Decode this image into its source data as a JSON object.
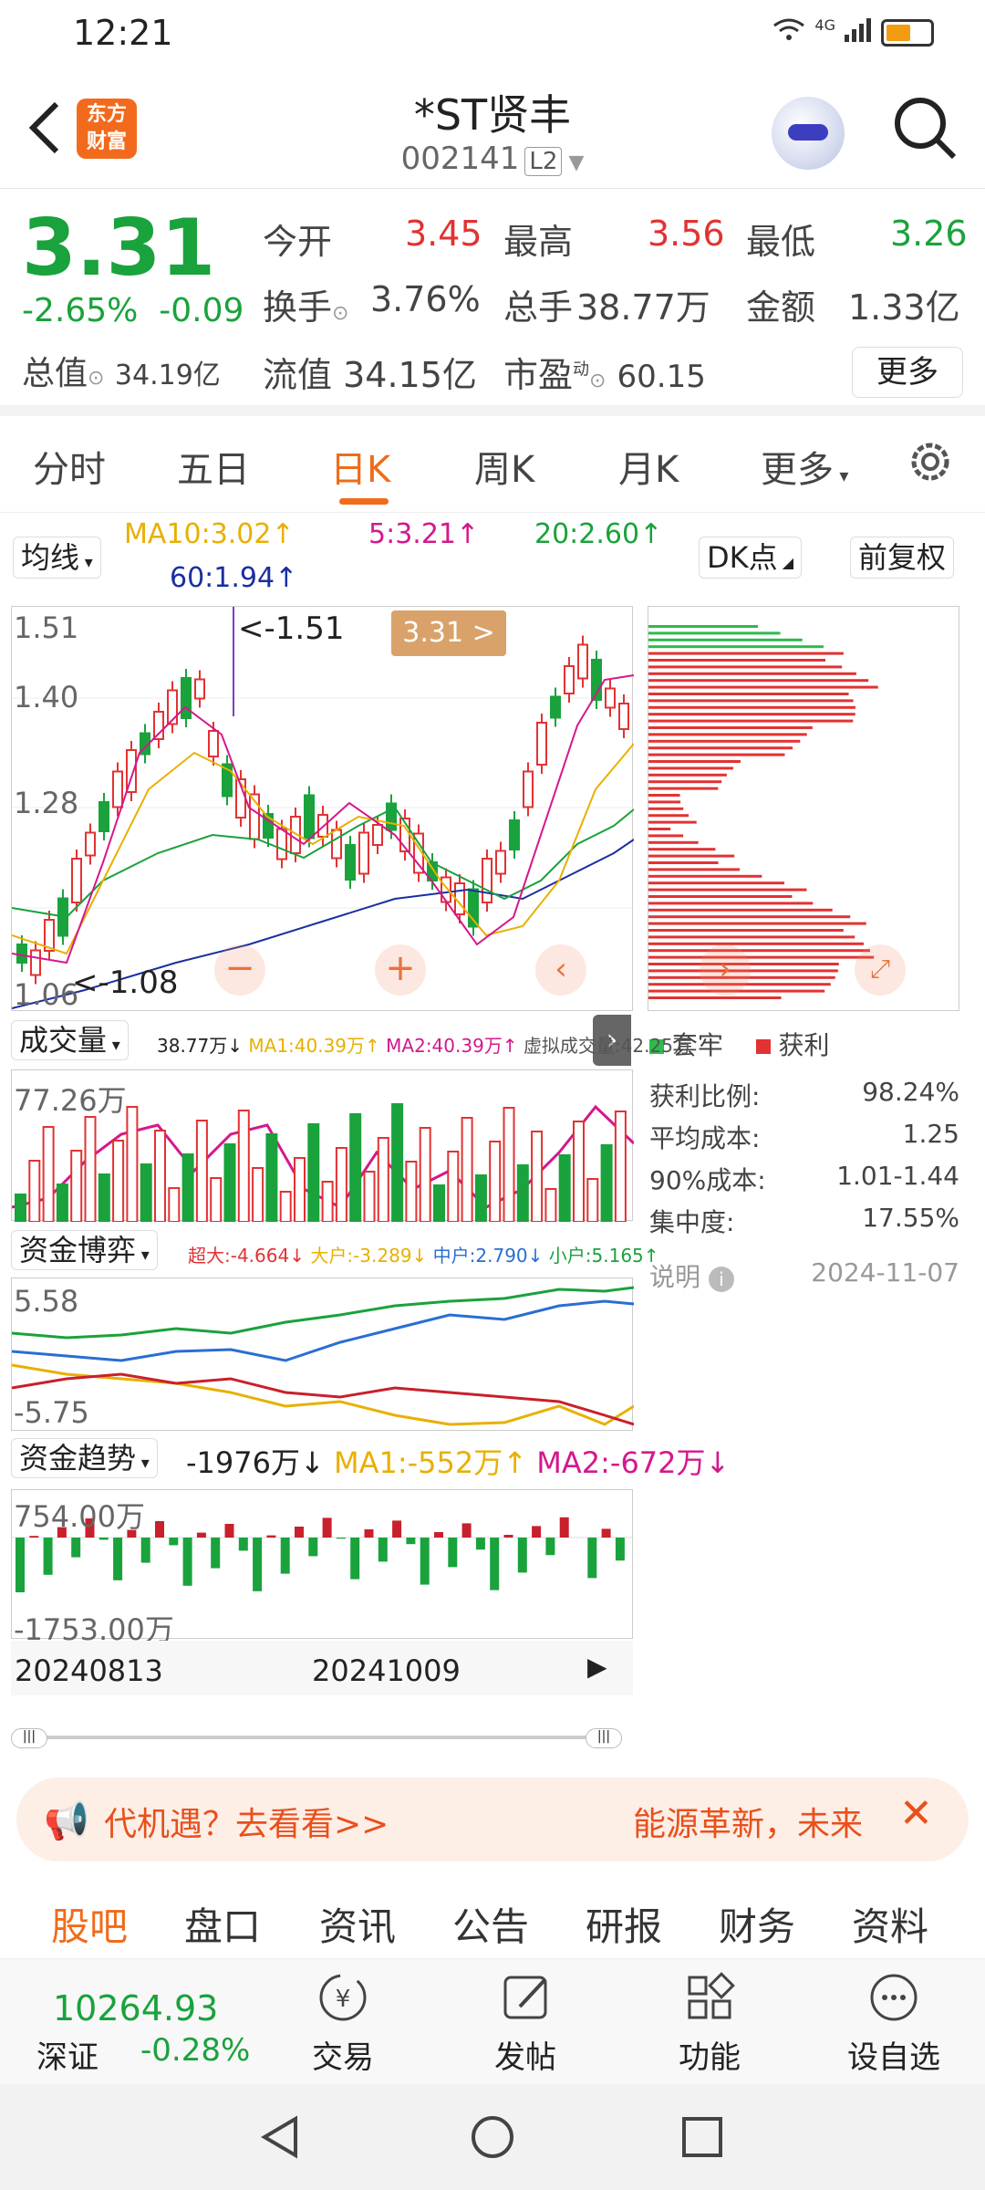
{
  "status": {
    "time": "12:21",
    "network": "4G"
  },
  "header": {
    "title": "*ST贤丰",
    "code": "002141",
    "level": "L2",
    "logo": [
      "东方",
      "财富"
    ]
  },
  "quote": {
    "price": "3.31",
    "pct": "-2.65%",
    "chg": "-0.09",
    "total_cap_label": "总值",
    "total_cap": "34.19亿",
    "open_label": "今开",
    "open": "3.45",
    "high_label": "最高",
    "high": "3.56",
    "low_label": "最低",
    "low": "3.26",
    "turnover_label": "换手",
    "turnover": "3.76%",
    "volume_label": "总手",
    "volume": "38.77万",
    "amount_label": "金额",
    "amount": "1.33亿",
    "float_label": "流值",
    "float_cap": "34.15亿",
    "pe_label": "市盈",
    "pe_sup": "动",
    "pe": "60.15",
    "more": "更多"
  },
  "tabs": [
    "分时",
    "五日",
    "日K",
    "周K",
    "月K",
    "更多"
  ],
  "kline": {
    "ma_select": "均线",
    "ma10": "MA10:3.02↑",
    "ma5": "5:3.21↑",
    "ma20": "20:2.60↑",
    "ma60": "60:1.94↑",
    "dk": "DK点",
    "adj": "前复权",
    "y_labels": [
      "1.51",
      "1.40",
      "1.28",
      "1.06"
    ],
    "high_mark": "<-1.51",
    "low_mark": "<-1.08",
    "price_tag": "3.31 >"
  },
  "chip": {
    "legend_a": "套牢",
    "legend_b": "获利",
    "rows": [
      {
        "k": "获利比例:",
        "v": "98.24%"
      },
      {
        "k": "平均成本:",
        "v": "1.25"
      },
      {
        "k": "90%成本:",
        "v": "1.01-1.44"
      },
      {
        "k": "集中度:",
        "v": "17.55%"
      }
    ],
    "note": "说明",
    "date": "2024-11-07"
  },
  "volume": {
    "select": "成交量",
    "info": [
      "38.77万↓",
      "MA1:40.39万↑",
      "MA2:40.39万↑",
      "虚拟成交量:42.25万"
    ],
    "y": "77.26万"
  },
  "fund": {
    "select": "资金博弈",
    "info": [
      "超大:-4.664↓",
      "大户:-3.289↓",
      "中户:2.790↓",
      "小户:5.165↑"
    ],
    "y_top": "5.58",
    "y_bot": "-5.75"
  },
  "trend": {
    "select": "资金趋势",
    "info": [
      "-1976万↓",
      "MA1:-552万↑",
      "MA2:-672万↓"
    ],
    "y_top": "754.00万",
    "y_bot": "-1753.00万"
  },
  "dates": [
    "20240813",
    "20241009"
  ],
  "banner": {
    "left": "代机遇？去看看>>",
    "right": "能源革新，未来"
  },
  "subtabs": [
    "股吧",
    "盘口",
    "资讯",
    "公告",
    "研报",
    "财务",
    "资料"
  ],
  "index": {
    "value": "10264.93",
    "name": "深证",
    "pct": "-0.28%"
  },
  "bottom": [
    "交易",
    "发帖",
    "功能",
    "设自选"
  ],
  "colors": {
    "up": "#e23232",
    "down": "#1aa23c",
    "accent": "#f06b1a"
  }
}
